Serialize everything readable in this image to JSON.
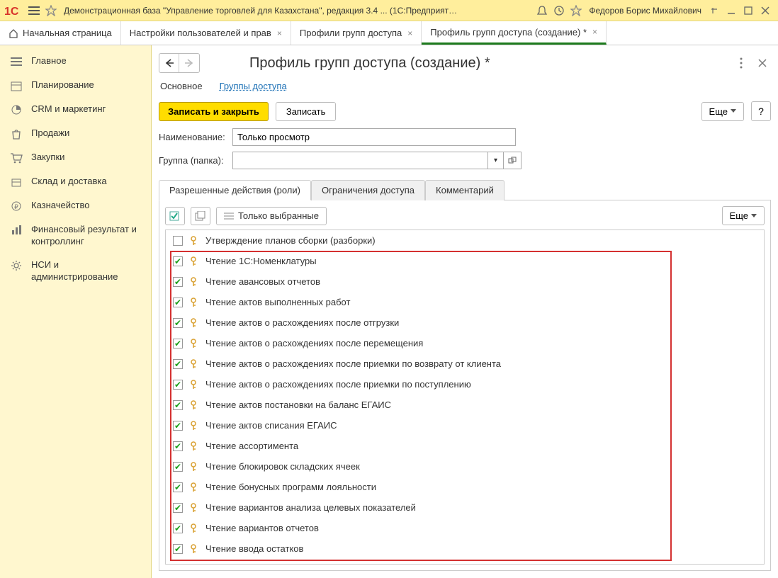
{
  "titlebar": {
    "app_title": "Демонстрационная база \"Управление торговлей для Казахстана\", редакция 3.4 ...  (1С:Предприятие)",
    "user": "Федоров Борис Михайлович"
  },
  "tabs": [
    {
      "label": "Начальная страница",
      "closable": false,
      "active": false,
      "home": true
    },
    {
      "label": "Настройки пользователей и прав",
      "closable": true,
      "active": false
    },
    {
      "label": "Профили групп доступа",
      "closable": true,
      "active": false
    },
    {
      "label": "Профиль групп доступа (создание) *",
      "closable": true,
      "active": true
    }
  ],
  "sidebar": [
    {
      "icon": "menu",
      "label": "Главное"
    },
    {
      "icon": "calendar",
      "label": "Планирование"
    },
    {
      "icon": "pie",
      "label": "CRM и маркетинг"
    },
    {
      "icon": "bag",
      "label": "Продажи"
    },
    {
      "icon": "cart",
      "label": "Закупки"
    },
    {
      "icon": "box",
      "label": "Склад и доставка"
    },
    {
      "icon": "coin",
      "label": "Казначейство"
    },
    {
      "icon": "bars",
      "label": "Финансовый результат и контроллинг"
    },
    {
      "icon": "gear",
      "label": "НСИ и администрирование"
    }
  ],
  "page": {
    "title": "Профиль групп доступа (создание) *",
    "link_tabs": {
      "main": "Основное",
      "groups": "Группы доступа"
    },
    "buttons": {
      "save_close": "Записать и закрыть",
      "save": "Записать",
      "more": "Еще",
      "help": "?"
    },
    "fields": {
      "name_label": "Наименование:",
      "name_value": "Только просмотр",
      "group_label": "Группа (папка):",
      "group_value": ""
    },
    "subtabs": {
      "roles": "Разрешенные действия (роли)",
      "restr": "Ограничения доступа",
      "comment": "Комментарий"
    },
    "only_selected": "Только выбранные",
    "more2": "Еще"
  },
  "roles": [
    {
      "checked": false,
      "label": "Утверждение планов сборки (разборки)"
    },
    {
      "checked": true,
      "label": "Чтение 1С:Номенклатуры"
    },
    {
      "checked": true,
      "label": "Чтение авансовых отчетов"
    },
    {
      "checked": true,
      "label": "Чтение актов выполненных работ"
    },
    {
      "checked": true,
      "label": "Чтение актов о расхождениях после отгрузки"
    },
    {
      "checked": true,
      "label": "Чтение актов о расхождениях после перемещения"
    },
    {
      "checked": true,
      "label": "Чтение актов о расхождениях после приемки по возврату от клиента"
    },
    {
      "checked": true,
      "label": "Чтение актов о расхождениях после приемки по поступлению"
    },
    {
      "checked": true,
      "label": "Чтение актов постановки на баланс ЕГАИС"
    },
    {
      "checked": true,
      "label": "Чтение актов списания ЕГАИС"
    },
    {
      "checked": true,
      "label": "Чтение ассортимента"
    },
    {
      "checked": true,
      "label": "Чтение блокировок складских ячеек"
    },
    {
      "checked": true,
      "label": "Чтение бонусных программ лояльности"
    },
    {
      "checked": true,
      "label": "Чтение вариантов анализа целевых показателей"
    },
    {
      "checked": true,
      "label": "Чтение вариантов отчетов"
    },
    {
      "checked": true,
      "label": "Чтение ввода остатков"
    }
  ]
}
